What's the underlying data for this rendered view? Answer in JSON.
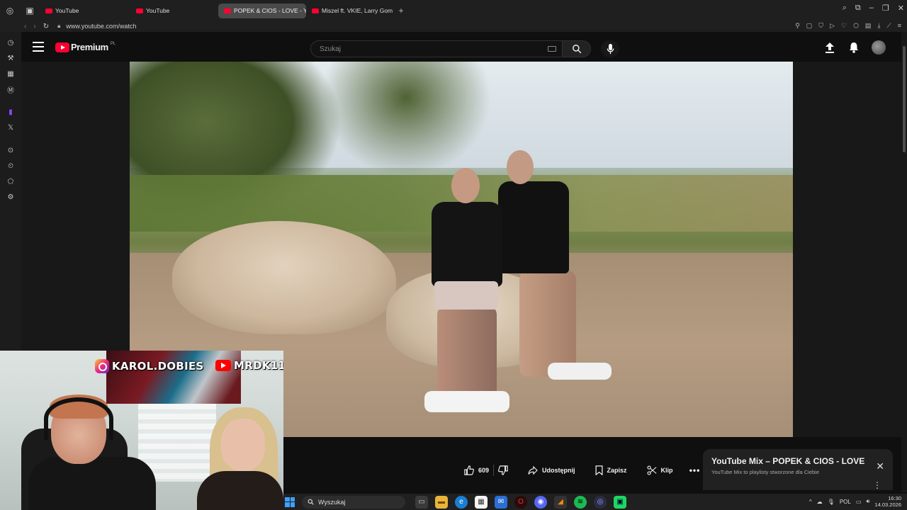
{
  "browser": {
    "tabs": [
      {
        "title": "YouTube",
        "active": false
      },
      {
        "title": "YouTube",
        "active": false
      },
      {
        "title": "POPEK & CIOS - LOVE - Y",
        "active": true
      },
      {
        "title": "Miszel ft. VKIE, Larry Gom",
        "active": false
      }
    ],
    "url": "www.youtube.com/watch"
  },
  "youtube": {
    "brand": "Premium",
    "region": "PL",
    "search_placeholder": "Szukaj"
  },
  "video": {
    "like_count": "609",
    "share_label": "Udostępnij",
    "save_label": "Zapisz",
    "clip_label": "Klip"
  },
  "mix_panel": {
    "title": "YouTube Mix – POPEK & CIOS - LOVE",
    "subtitle": "YouTube Mix to playlisty stworzone dla Ciebie"
  },
  "webcam": {
    "instagram_handle": "KAROL.DOBIES",
    "youtube_handle": "MRDK11"
  },
  "taskbar": {
    "search_placeholder": "Wyszukaj",
    "language": "POL",
    "time": "16:30",
    "date": "14.03.2026"
  },
  "colors": {
    "accent_red": "#ff0033",
    "background": "#0f0f0f",
    "twitch_purple": "#9146ff"
  }
}
